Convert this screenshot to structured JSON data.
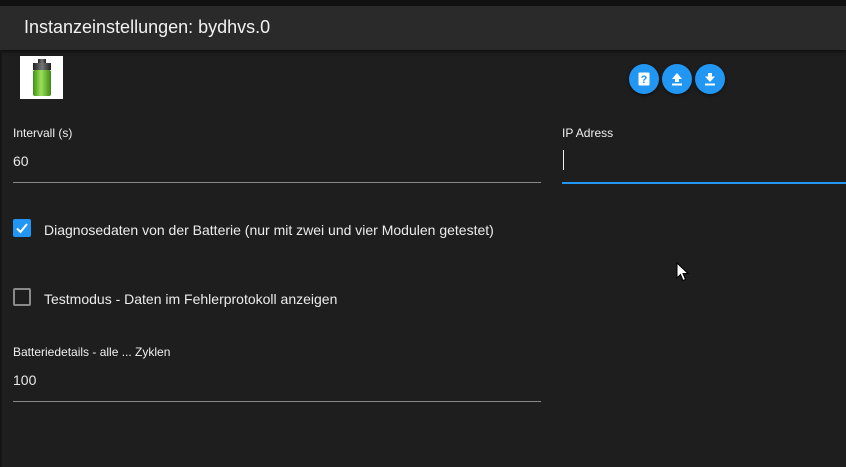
{
  "header": {
    "title": "Instanzeinstellungen: bydhvs.0"
  },
  "logo": {
    "icon": "battery-icon",
    "colors": {
      "body": "#66bb2a",
      "cap": "#444444"
    }
  },
  "toolbar": {
    "buttons": [
      {
        "icon": "help-icon"
      },
      {
        "icon": "upload-icon"
      },
      {
        "icon": "download-icon"
      }
    ],
    "accent": "#2196f3"
  },
  "form": {
    "interval": {
      "label": "Intervall (s)",
      "value": "60"
    },
    "ip": {
      "label": "IP Adress",
      "value": ""
    },
    "diagnostics": {
      "label": "Diagnosedaten von der Batterie (nur mit zwei und vier Modulen getestet)",
      "checked": true
    },
    "testmode": {
      "label": "Testmodus - Daten im Fehlerprotokoll anzeigen",
      "checked": false
    },
    "battery_details": {
      "label": "Batteriedetails - alle ... Zyklen",
      "value": "100"
    }
  }
}
